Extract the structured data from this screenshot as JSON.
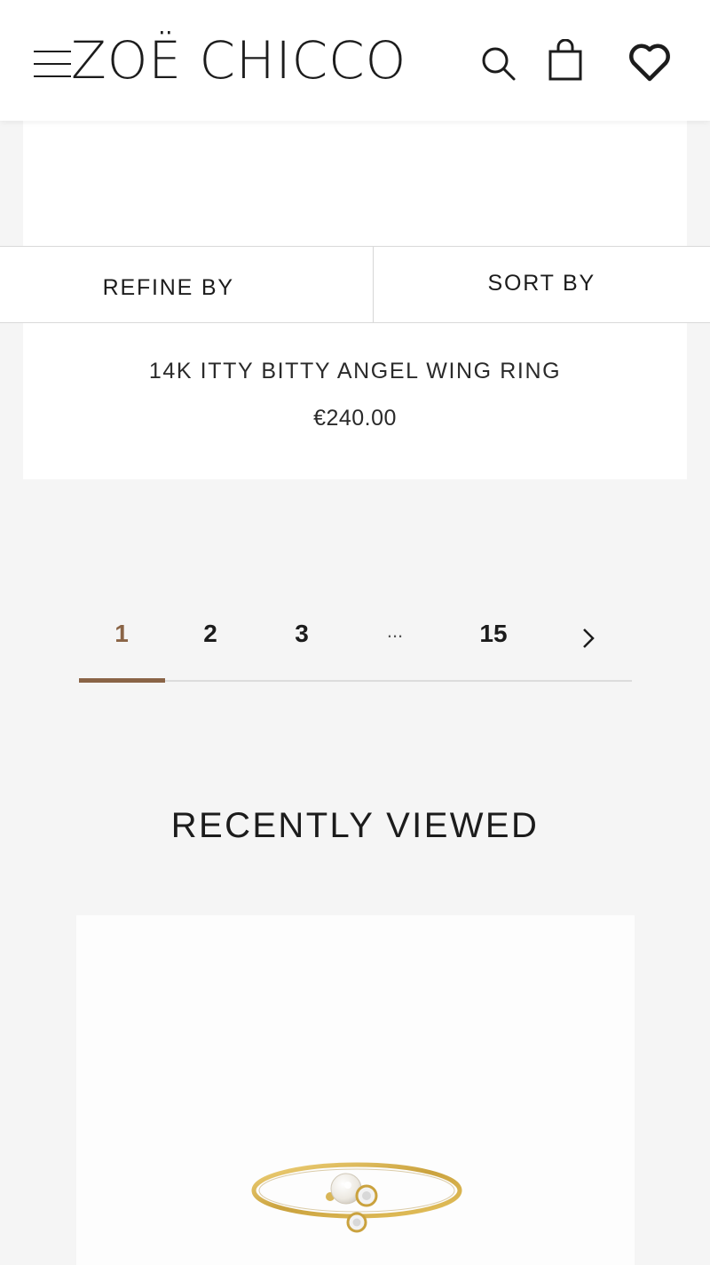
{
  "header": {
    "brand": "ZOË CHICCO",
    "icons": [
      "menu-icon",
      "search-icon",
      "bag-icon",
      "heart-icon"
    ]
  },
  "product": {
    "name": "14K ITTY BITTY ANGEL WING RING",
    "price": "€240.00"
  },
  "filters": {
    "refine_label": "REFINE BY",
    "sort_label": "SORT BY"
  },
  "pagination": {
    "current": "1",
    "pages": [
      "1",
      "2",
      "3",
      "...",
      "15"
    ],
    "next_icon": "chevron-right-icon"
  },
  "recently_viewed": {
    "title": "RECENTLY VIEWED"
  },
  "colors": {
    "accent": "#8a6446",
    "background": "#f5f5f5",
    "card": "#ffffff"
  }
}
